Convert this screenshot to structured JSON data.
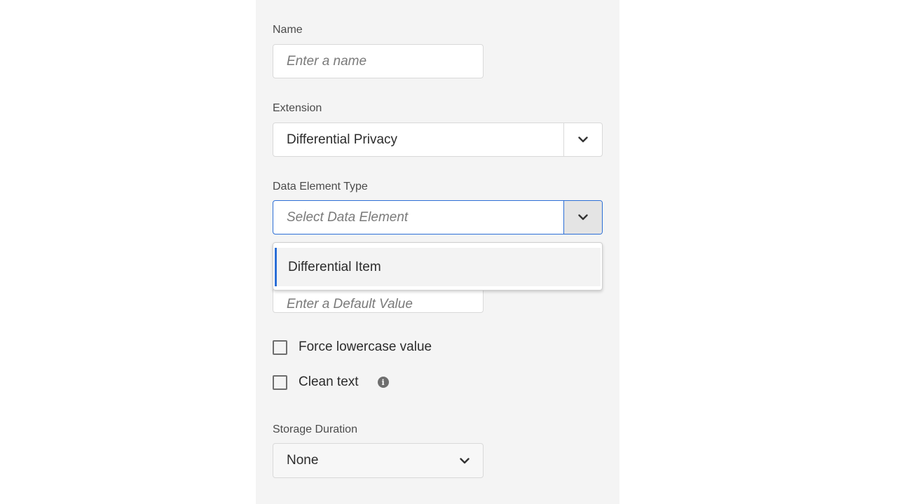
{
  "form": {
    "name": {
      "label": "Name",
      "placeholder": "Enter a name"
    },
    "extension": {
      "label": "Extension",
      "value": "Differential Privacy",
      "icon": "chevron-down-icon"
    },
    "data_element_type": {
      "label": "Data Element Type",
      "placeholder": "Select Data Element",
      "icon": "chevron-down-icon",
      "options": [
        "Differential Item"
      ]
    },
    "default_value": {
      "placeholder": "Enter a Default Value"
    },
    "force_lowercase": {
      "label": "Force lowercase value",
      "checked": false
    },
    "clean_text": {
      "label": "Clean text",
      "checked": false,
      "info_icon": "info-icon",
      "info_glyph": "i"
    },
    "storage_duration": {
      "label": "Storage Duration",
      "value": "None",
      "icon": "chevron-down-icon"
    }
  },
  "colors": {
    "accent": "#2b6ed6",
    "panel_bg": "#f4f4f4"
  }
}
